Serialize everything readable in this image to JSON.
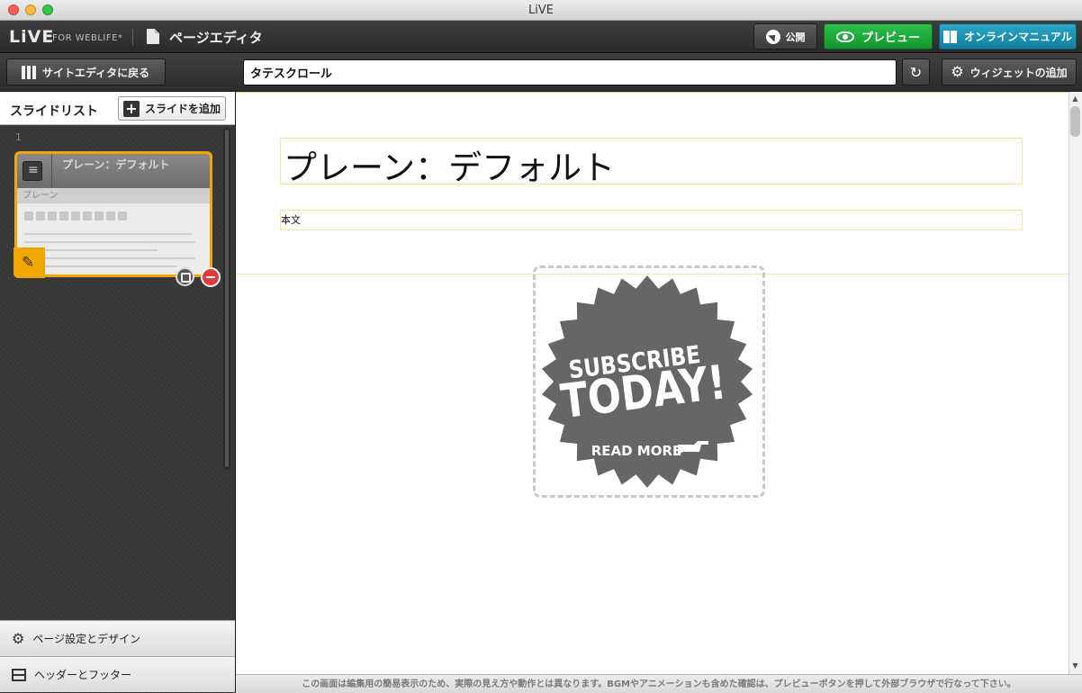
{
  "window": {
    "title": "LiVE"
  },
  "appbar": {
    "logo": "LiVE",
    "logo_sub": "FOR WEBLIFE*",
    "page_title": "ページエディタ",
    "publish_label": "公開",
    "preview_label": "プレビュー",
    "manual_label": "オンラインマニュアル"
  },
  "toolbar": {
    "back_label": "サイトエディタに戻る",
    "title_value": "タテスクロール",
    "add_widget_label": "ウィジェットの追加"
  },
  "sidebar": {
    "slide_list_title": "スライドリスト",
    "add_slide_label": "スライドを追加",
    "slides": [
      {
        "number": "1",
        "title": "プレーン：デフォルト",
        "subtitle": "プレーン"
      }
    ],
    "page_settings_label": "ページ設定とデザイン",
    "header_footer_label": "ヘッダーとフッター"
  },
  "canvas": {
    "heading": "プレーン：デフォルト",
    "body": "本文",
    "badge": {
      "line1": "SUBSCRIBE",
      "line2": "TODAY!",
      "line3": "READ MORE",
      "color": "#666666"
    }
  },
  "footer_note": "この画面は編集用の簡易表示のため、実際の見え方や動作とは異なります。BGMやアニメーションも含めた確認は、プレビューボタンを押して外部ブラウザで行なって下さい。",
  "colors": {
    "preview": "#1ba83a",
    "manual": "#1a93b3",
    "accent": "#f0a800",
    "remove": "#e23b3b"
  }
}
